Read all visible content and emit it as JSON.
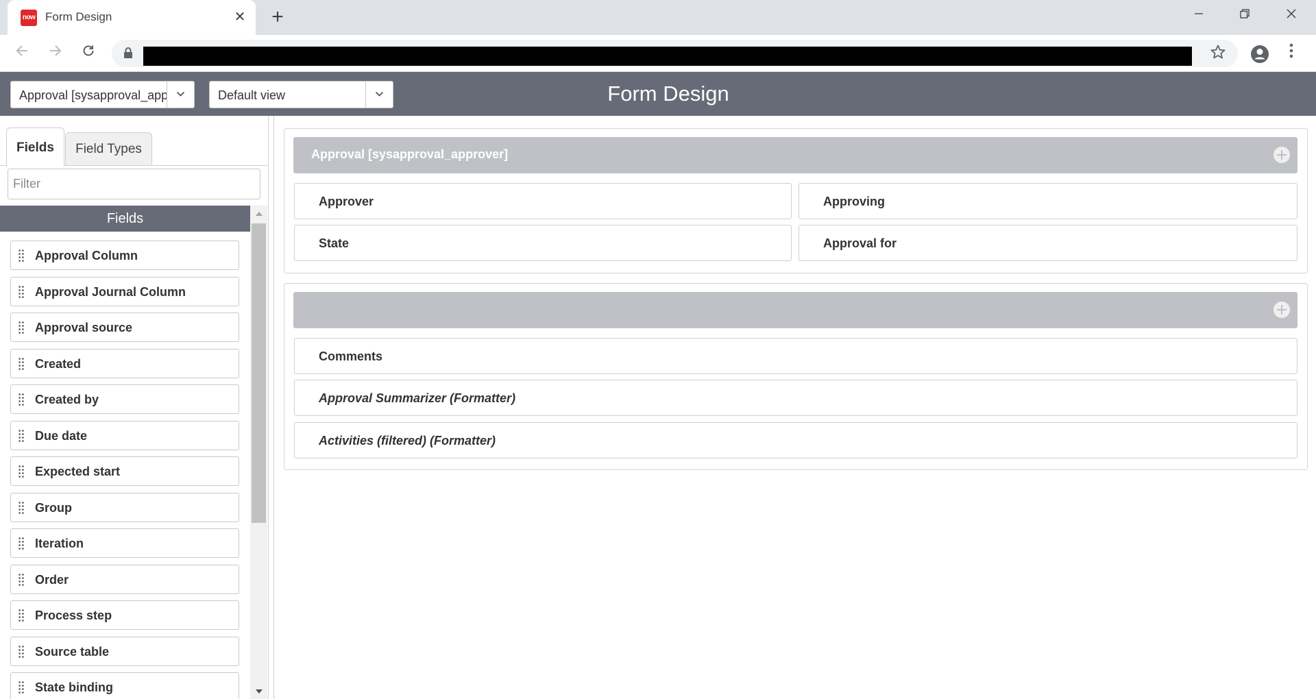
{
  "browser": {
    "tab_title": "Form Design",
    "favicon_text": "now",
    "new_tab_symbol": "+",
    "close_symbol": "✕"
  },
  "header": {
    "table_select": "Approval [sysapproval_approver]",
    "view_select": "Default view",
    "title": "Form Design"
  },
  "left_panel": {
    "tabs": [
      {
        "label": "Fields",
        "active": true
      },
      {
        "label": "Field Types",
        "active": false
      }
    ],
    "filter_placeholder": "Filter",
    "fields_header": "Fields",
    "fields": [
      "Approval Column",
      "Approval Journal Column",
      "Approval source",
      "Created",
      "Created by",
      "Due date",
      "Expected start",
      "Group",
      "Iteration",
      "Order",
      "Process step",
      "Source table",
      "State binding"
    ]
  },
  "sections": [
    {
      "title": "Approval [sysapproval_approver]",
      "fields": [
        "Approver",
        "Approving",
        "State",
        "Approval for"
      ]
    },
    {
      "title": "",
      "fields": [
        "Comments",
        "Approval Summarizer (Formatter)",
        "Activities (filtered) (Formatter)"
      ]
    }
  ],
  "colors": {
    "app_header": "#676b77",
    "section_header": "#bfc1c6",
    "favicon": "#e0292b"
  }
}
